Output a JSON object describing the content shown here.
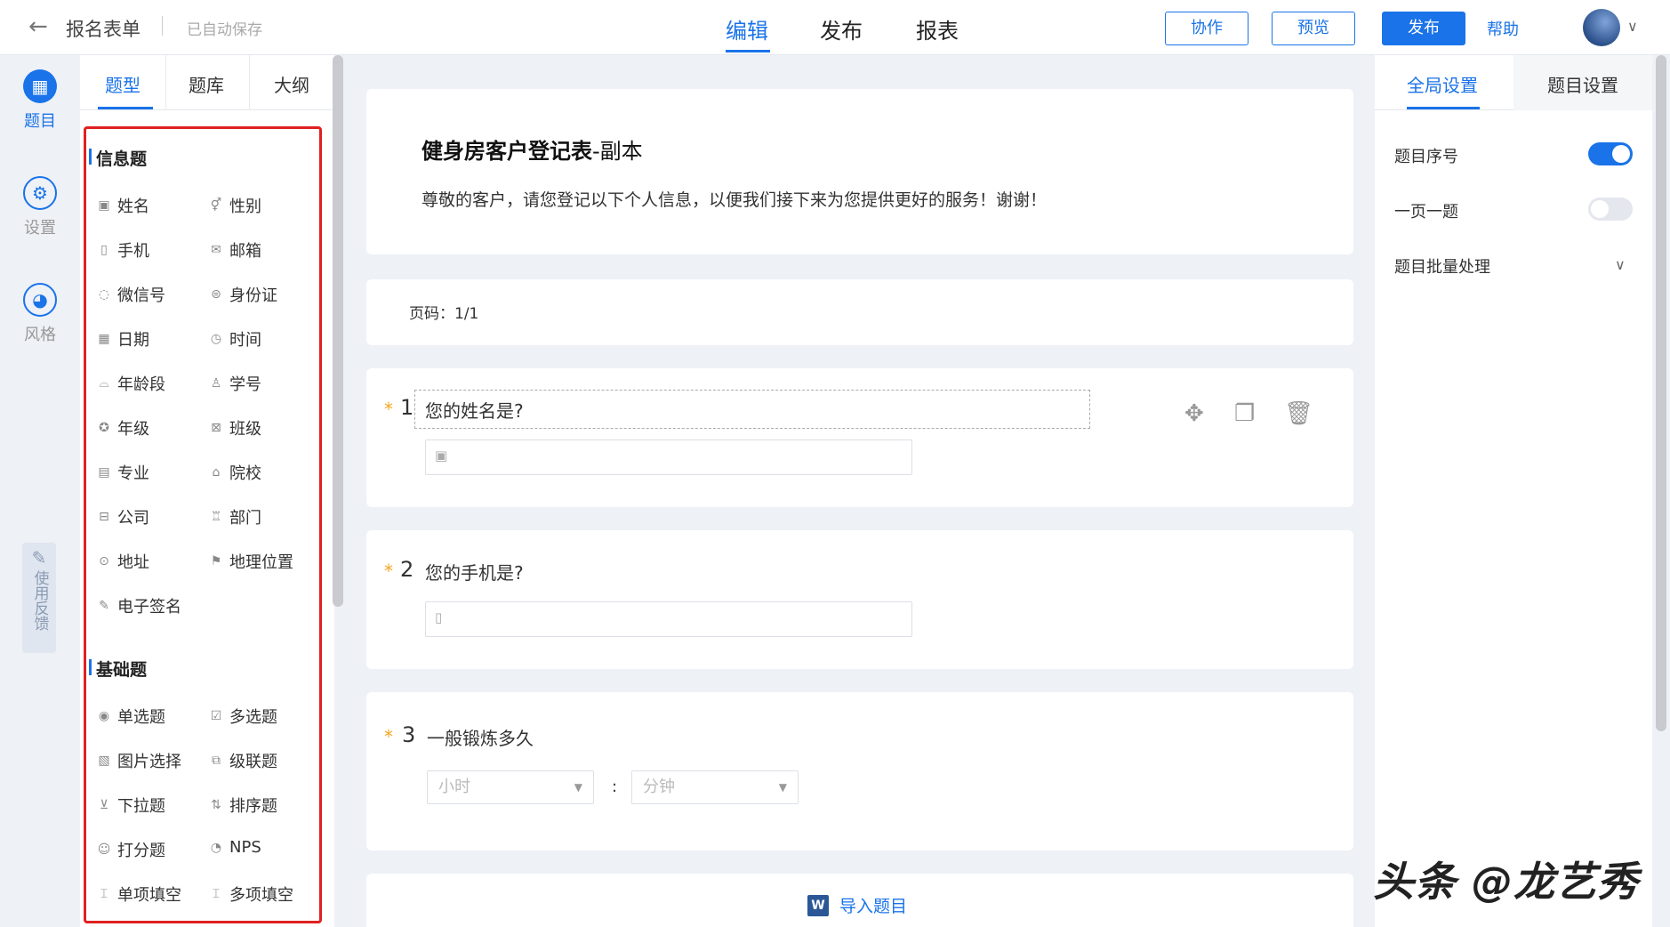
{
  "header": {
    "back_icon": "arrow-left-icon",
    "form_title": "报名表单",
    "autosave": "已自动保存",
    "tabs": [
      "编辑",
      "发布",
      "报表"
    ],
    "buttons": {
      "collab": "协作",
      "preview": "预览",
      "publish": "发布"
    },
    "help": "帮助",
    "accent": "#1a73e8"
  },
  "rail": {
    "items": [
      {
        "label": "题目",
        "icon": "grid-icon",
        "active": true
      },
      {
        "label": "设置",
        "icon": "gear-icon",
        "active": false
      },
      {
        "label": "风格",
        "icon": "palette-icon",
        "active": false
      }
    ],
    "feedback": "使用反馈"
  },
  "panel": {
    "tabs": [
      "题型",
      "题库",
      "大纲"
    ],
    "info_title": "信息题",
    "info_items": [
      "姓名",
      "性别",
      "手机",
      "邮箱",
      "微信号",
      "身份证",
      "日期",
      "时间",
      "年龄段",
      "学号",
      "年级",
      "班级",
      "专业",
      "院校",
      "公司",
      "部门",
      "地址",
      "地理位置",
      "电子签名"
    ],
    "basic_title": "基础题",
    "basic_items": [
      "单选题",
      "多选题",
      "图片选择",
      "级联题",
      "下拉题",
      "排序题",
      "打分题",
      "NPS",
      "单项填空",
      "多项填空"
    ]
  },
  "canvas": {
    "title_bold": "健身房客户登记表",
    "title_suffix": "-副本",
    "description": "尊敬的客户，请您登记以下个人信息，以便我们接下来为您提供更好的服务！谢谢！",
    "page_label": "页码：1/1",
    "questions": [
      {
        "num": "1",
        "title": "您的姓名是?"
      },
      {
        "num": "2",
        "title": "您的手机是?"
      },
      {
        "num": "3",
        "title": "一般锻炼多久",
        "select_hour": "小时",
        "select_min": "分钟",
        "colon": ":"
      }
    ],
    "import_label": "导入题目"
  },
  "settings": {
    "tabs": [
      "全局设置",
      "题目设置"
    ],
    "rows": [
      {
        "label": "题目序号",
        "toggle": "on"
      },
      {
        "label": "一页一题",
        "toggle": "off"
      },
      {
        "label": "题目批量处理"
      }
    ]
  },
  "watermark": "头条 @龙艺秀"
}
